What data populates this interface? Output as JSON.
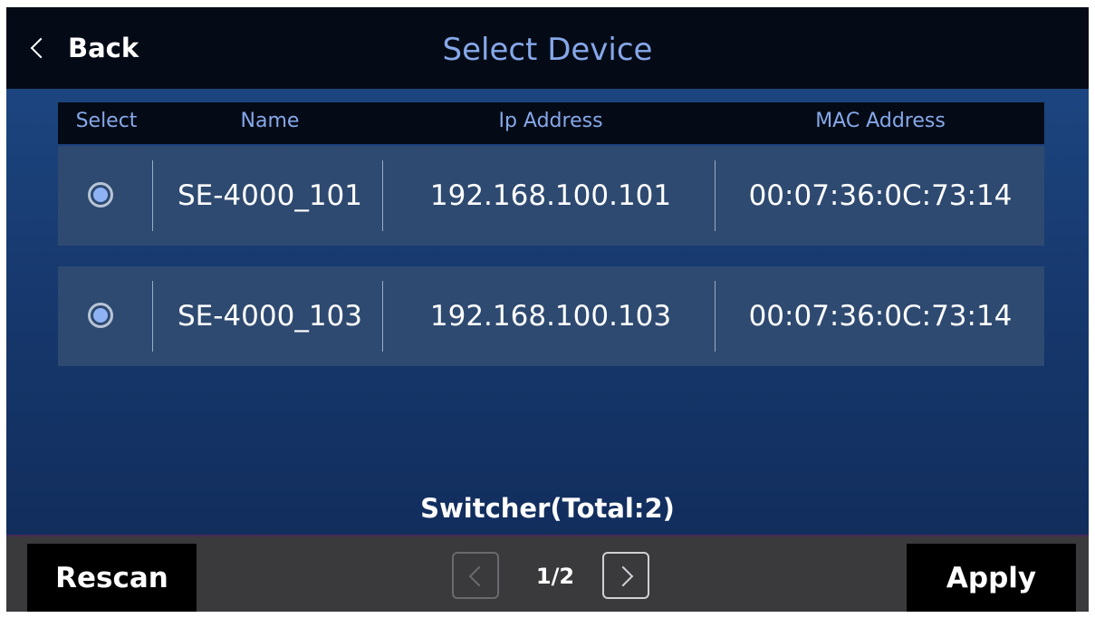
{
  "header": {
    "back_label": "Back",
    "title": "Select Device"
  },
  "table": {
    "columns": [
      "Select",
      "Name",
      "Ip Address",
      "MAC Address"
    ],
    "rows": [
      {
        "selected": true,
        "name": "SE-4000_101",
        "ip": "192.168.100.101",
        "mac": "00:07:36:0C:73:14"
      },
      {
        "selected": true,
        "name": "SE-4000_103",
        "ip": "192.168.100.103",
        "mac": "00:07:36:0C:73:14"
      }
    ]
  },
  "status": {
    "total_text": "Switcher(Total:2)"
  },
  "footer": {
    "rescan_label": "Rescan",
    "apply_label": "Apply",
    "page_indicator": "1/2"
  },
  "colors": {
    "accent": "#86a8ea",
    "radio_fill": "#8fb2f4",
    "row_bg": "#2e4a71",
    "header_bg": "#050b16"
  },
  "icons": {
    "back": "chevron-left-icon",
    "prev_page": "chevron-left-icon",
    "next_page": "chevron-right-icon",
    "radio": "radio-selected-icon"
  }
}
